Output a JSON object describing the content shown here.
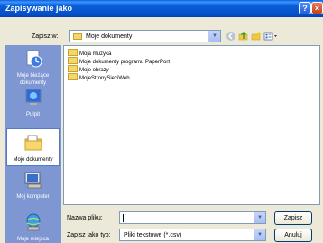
{
  "window": {
    "title": "Zapisywanie jako",
    "help_btn": "?",
    "close_btn": "×"
  },
  "savein": {
    "label": "Zapisz w:",
    "value": "Moje dokumenty"
  },
  "toolbar": [
    "back-icon",
    "up-folder-icon",
    "new-folder-icon",
    "views-icon"
  ],
  "places": [
    {
      "label": "Moje bieżące dokumenty",
      "icon": "recent-documents-icon"
    },
    {
      "label": "Pulpit",
      "icon": "desktop-icon"
    },
    {
      "label": "Moje dokumenty",
      "icon": "my-documents-icon"
    },
    {
      "label": "Mój komputer",
      "icon": "my-computer-icon"
    },
    {
      "label": "Moje miejsca",
      "icon": "network-places-icon"
    }
  ],
  "files": [
    "Moja muzyka",
    "Moje dokumenty programu PaperPort",
    "Moje obrazy",
    "MojeStronySieciWeb"
  ],
  "filename": {
    "label": "Nazwa pliku:",
    "value": ""
  },
  "filetype": {
    "label": "Zapisz jako typ:",
    "value": "Pliki tekstowe (*.csv)"
  },
  "buttons": {
    "save": "Zapisz",
    "cancel": "Anuluj"
  },
  "colors": {
    "titlebar": "#0a5fd8",
    "places_bar": "#7e96d2",
    "dialog_bg": "#ece9d8"
  }
}
